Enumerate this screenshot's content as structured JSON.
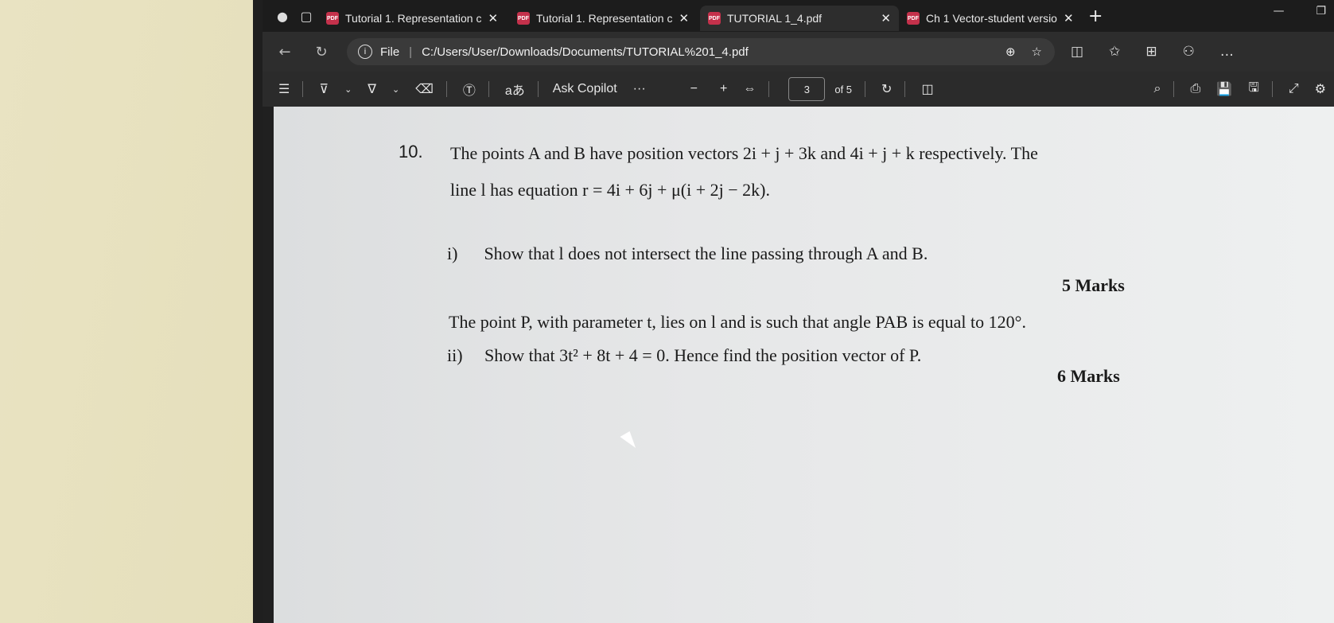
{
  "tabs": [
    {
      "title": "Tutorial 1. Representation c",
      "active": false
    },
    {
      "title": "Tutorial 1. Representation c",
      "active": false
    },
    {
      "title": "TUTORIAL 1_4.pdf",
      "active": true
    },
    {
      "title": "Ch 1 Vector-student versio",
      "active": false
    }
  ],
  "address": {
    "label": "File",
    "url": "C:/Users/User/Downloads/Documents/TUTORIAL%201_4.pdf"
  },
  "pdf_toolbar": {
    "ask_copilot": "Ask Copilot",
    "text_tool": "aあ",
    "more": "···",
    "zoom_out": "−",
    "zoom_in": "+",
    "page_current": "3",
    "page_total": "of 5"
  },
  "document": {
    "question_number": "10.",
    "intro_line1": "The points A and B have position vectors 2i + j + 3k and 4i + j + k respectively. The",
    "intro_line2": "line l has equation r = 4i + 6j + μ(i + 2j − 2k).",
    "part_i": "i)      Show that l does not intersect the line passing through A and B.",
    "part_i_marks": "5 Marks",
    "context_line": "The point P, with parameter t, lies on l and is such that angle PAB is equal to 120°.",
    "part_ii": "ii)     Show that 3t² + 8t + 4 = 0. Hence find the position vector of P.",
    "part_ii_marks": "6 Marks"
  }
}
